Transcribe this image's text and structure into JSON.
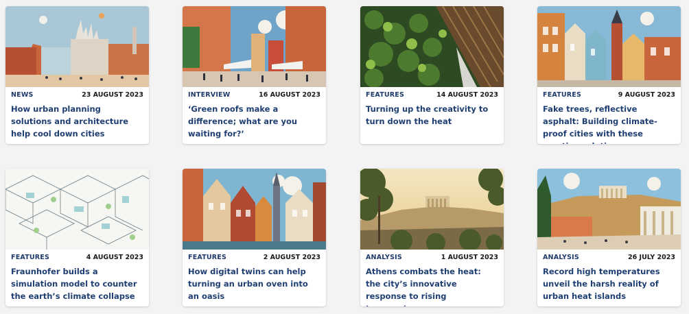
{
  "articles": [
    {
      "category": "NEWS",
      "date": "23 AUGUST 2023",
      "title": "How urban planning solutions and architecture help cool down cities",
      "image": "milan-cathedral-illustration"
    },
    {
      "category": "INTERVIEW",
      "date": "16 AUGUST 2023",
      "title": "‘Green roofs make a difference; what are you waiting for?’",
      "image": "street-cafe-illustration"
    },
    {
      "category": "FEATURES",
      "date": "14 AUGUST 2023",
      "title": "Turning up the creativity to turn down the heat",
      "image": "green-wall-photo"
    },
    {
      "category": "FEATURES",
      "date": "9 AUGUST 2023",
      "title": "Fake trees, reflective asphalt: Building climate-proof cities with these creative solutions",
      "image": "colorful-townhouses-illustration"
    },
    {
      "category": "FEATURES",
      "date": "4 AUGUST 2023",
      "title": "Fraunhofer builds a simulation model to counter the earth’s climate collapse",
      "image": "isometric-city-drawing"
    },
    {
      "category": "FEATURES",
      "date": "2 AUGUST 2023",
      "title": "How digital twins can help turning an urban oven into an oasis",
      "image": "gabled-houses-illustration"
    },
    {
      "category": "ANALYSIS",
      "date": "1 AUGUST 2023",
      "title": "Athens combats the heat: the city’s innovative response to rising temperatures",
      "image": "acropolis-photo"
    },
    {
      "category": "ANALYSIS",
      "date": "26 JULY 2023",
      "title": "Record high temperatures unveil the harsh reality of urban heat islands",
      "image": "acropolis-illustration"
    }
  ]
}
